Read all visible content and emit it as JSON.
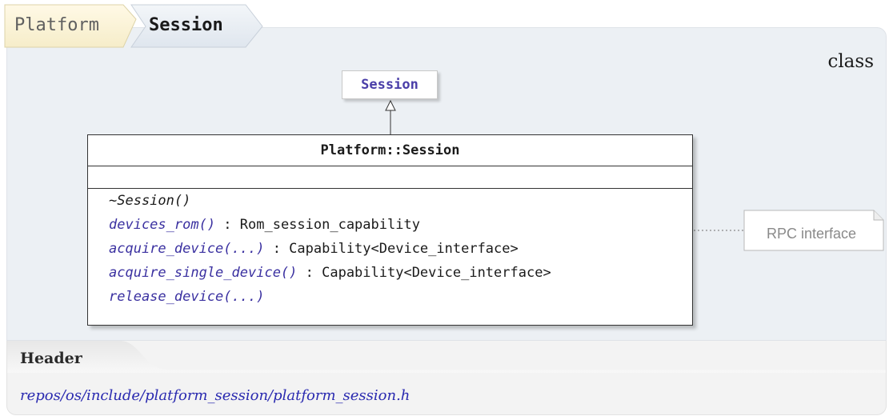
{
  "breadcrumb": {
    "items": [
      "Platform",
      "Session"
    ]
  },
  "kind_label": "class",
  "parent_class": "Session",
  "class_box": {
    "name": "Platform::Session",
    "operations": [
      {
        "name": "~Session()",
        "type": "",
        "link": false
      },
      {
        "name": "devices_rom()",
        "type": " : Rom_session_capability",
        "link": true
      },
      {
        "name": "acquire_device(...)",
        "type": " : Capability<Device_interface>",
        "link": true
      },
      {
        "name": "acquire_single_device()",
        "type": " : Capability<Device_interface>",
        "link": true
      },
      {
        "name": "release_device(...)",
        "type": "",
        "link": true
      }
    ]
  },
  "note": "RPC interface",
  "header": {
    "label": "Header",
    "path": "repos/os/include/platform_session/platform_session.h"
  },
  "colors": {
    "panel": "#ecf0f4",
    "crumb_first": "#fdf6dc",
    "crumb_second": "#e9eef4",
    "link": "#3a30a0",
    "parent_link": "#4a3ea8",
    "path_link": "#2a2ab0"
  }
}
